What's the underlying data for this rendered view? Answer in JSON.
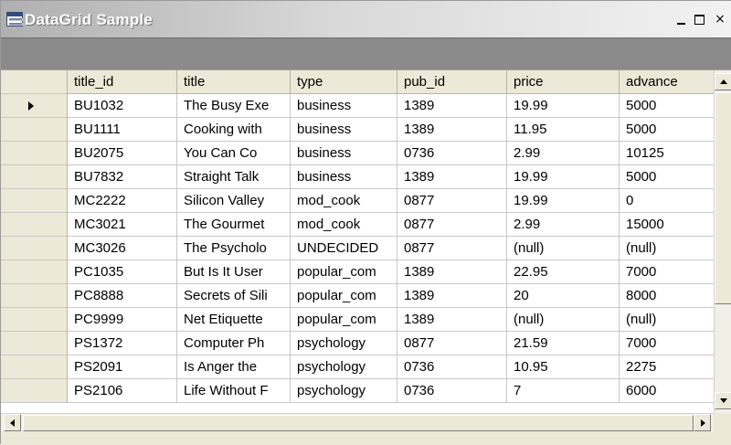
{
  "window": {
    "title": "DataGrid Sample",
    "minimize_label": "_",
    "maximize_label": "□",
    "close_label": "×"
  },
  "grid": {
    "columns": [
      "title_id",
      "title",
      "type",
      "pub_id",
      "price",
      "advance"
    ],
    "rows": [
      [
        "BU1032",
        "The Busy Exe",
        "business",
        "1389",
        "19.99",
        "5000"
      ],
      [
        "BU1111",
        "Cooking with",
        "business",
        "1389",
        "11.95",
        "5000"
      ],
      [
        "BU2075",
        "You Can Co",
        "business",
        "0736",
        "2.99",
        "10125"
      ],
      [
        "BU7832",
        "Straight Talk",
        "business",
        "1389",
        "19.99",
        "5000"
      ],
      [
        "MC2222",
        "Silicon Valley",
        "mod_cook",
        "0877",
        "19.99",
        "0"
      ],
      [
        "MC3021",
        "The Gourmet",
        "mod_cook",
        "0877",
        "2.99",
        "15000"
      ],
      [
        "MC3026",
        "The Psycholo",
        "UNDECIDED",
        "0877",
        "(null)",
        "(null)"
      ],
      [
        "PC1035",
        "But Is It User",
        "popular_com",
        "1389",
        "22.95",
        "7000"
      ],
      [
        "PC8888",
        "Secrets of Sili",
        "popular_com",
        "1389",
        "20",
        "8000"
      ],
      [
        "PC9999",
        "Net Etiquette",
        "popular_com",
        "1389",
        "(null)",
        "(null)"
      ],
      [
        "PS1372",
        "Computer Ph",
        "psychology",
        "0877",
        "21.59",
        "7000"
      ],
      [
        "PS2091",
        "Is Anger the",
        "psychology",
        "0736",
        "10.95",
        "2275"
      ],
      [
        "PS2106",
        "Life Without F",
        "psychology",
        "0736",
        "7",
        "6000"
      ]
    ],
    "current_row": 0
  },
  "colors": {
    "caption_strip": "#8a8a8a",
    "header_bg": "#ece9d8",
    "grid_bg": "#ffffff"
  }
}
